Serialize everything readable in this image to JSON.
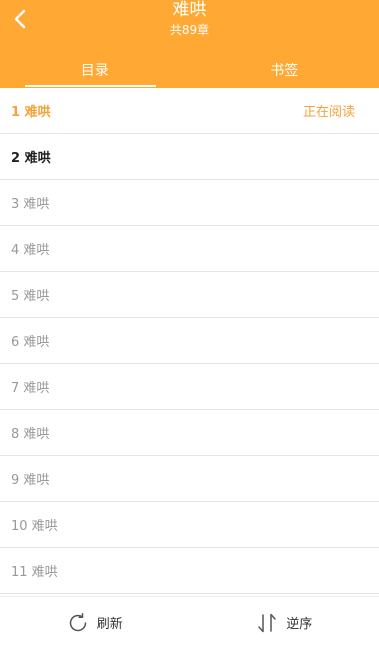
{
  "header": {
    "title": "难哄",
    "subtitle": "共89章",
    "back_icon": "chevron-left-icon",
    "bg_color": "#FFA833"
  },
  "tabs": [
    {
      "label": "目录",
      "active": true
    },
    {
      "label": "书签",
      "active": false
    }
  ],
  "chapters": [
    {
      "label": "1 难哄",
      "status": "正在阅读"
    },
    {
      "label": "2 难哄"
    },
    {
      "label": "3 难哄"
    },
    {
      "label": "4 难哄"
    },
    {
      "label": "5 难哄"
    },
    {
      "label": "6 难哄"
    },
    {
      "label": "7 难哄"
    },
    {
      "label": "8 难哄"
    },
    {
      "label": "9 难哄"
    },
    {
      "label": "10 难哄"
    },
    {
      "label": "11 难哄"
    }
  ],
  "footer": {
    "refresh_label": "刷新",
    "refresh_icon": "refresh-icon",
    "reverse_label": "逆序",
    "reverse_icon": "sort-reverse-icon"
  },
  "colors": {
    "accent": "#F3A33A",
    "divider": "#e5e5e5"
  }
}
